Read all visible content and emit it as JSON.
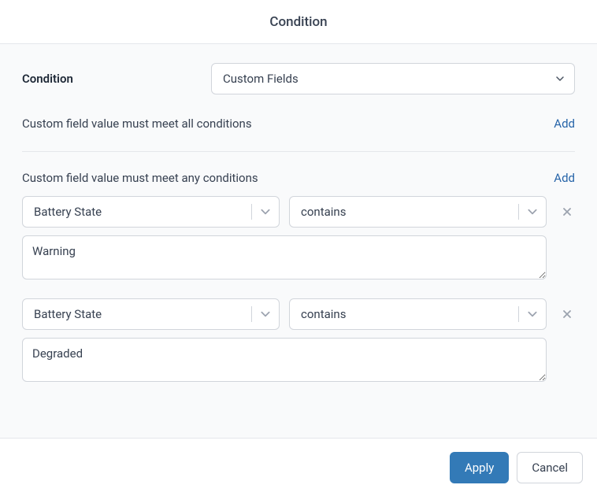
{
  "header": {
    "title": "Condition"
  },
  "condition": {
    "label": "Condition",
    "selected": "Custom Fields"
  },
  "sections": {
    "all": {
      "title": "Custom field value must meet all conditions",
      "add_label": "Add"
    },
    "any": {
      "title": "Custom field value must meet any conditions",
      "add_label": "Add",
      "conditions": [
        {
          "field": "Battery State",
          "operator": "contains",
          "value": "Warning"
        },
        {
          "field": "Battery State",
          "operator": "contains",
          "value": "Degraded"
        }
      ]
    }
  },
  "footer": {
    "apply": "Apply",
    "cancel": "Cancel"
  }
}
